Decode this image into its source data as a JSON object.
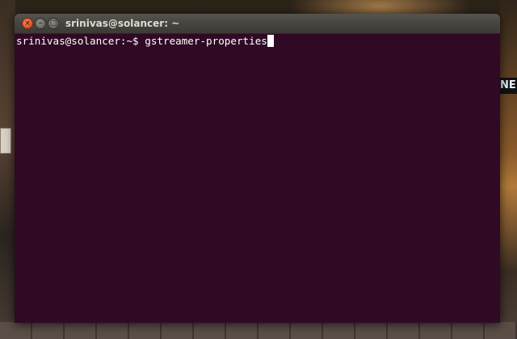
{
  "wallpaper": {
    "sign_text": "NE"
  },
  "window": {
    "title": "srinivas@solancer: ~",
    "controls": {
      "close": "×",
      "minimize": "–",
      "maximize": "□"
    }
  },
  "terminal": {
    "background": "#300a24",
    "prompt": "srinivas@solancer:~$ ",
    "command": "gstreamer-properties"
  },
  "colors": {
    "close_button": "#e2572b",
    "titlebar": "#46453f",
    "title_text": "#dfdbd2"
  }
}
